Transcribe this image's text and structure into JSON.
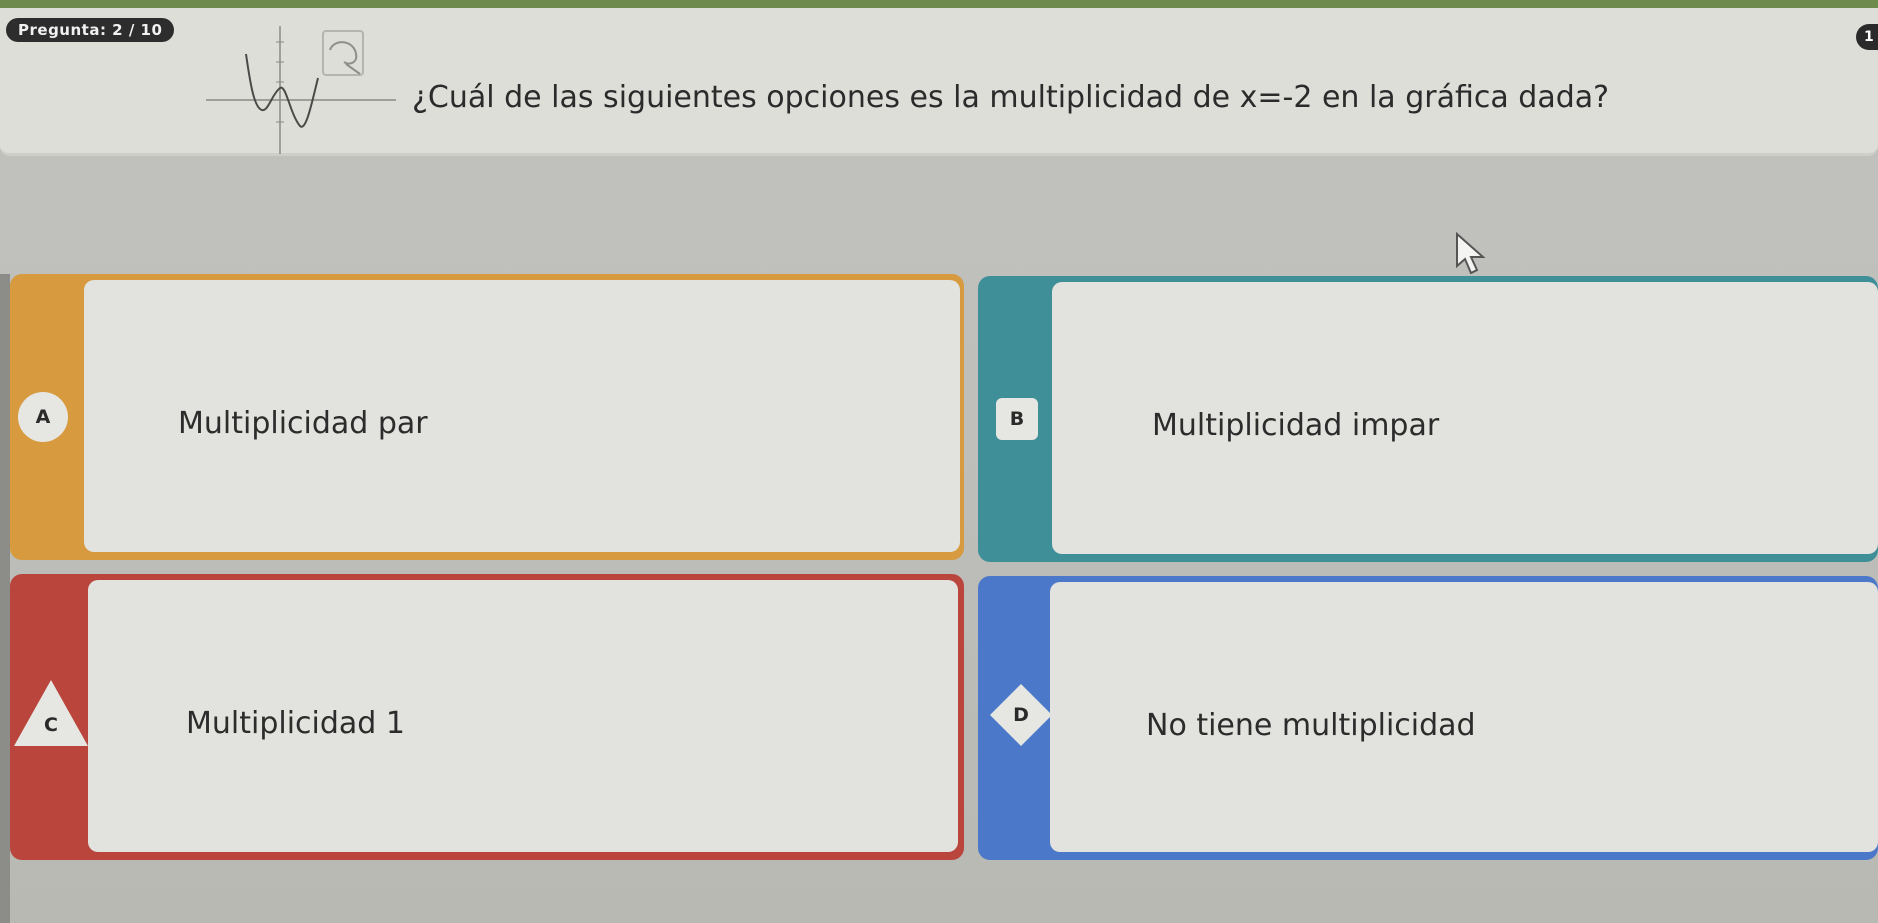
{
  "header": {
    "question_counter": "Pregunta: 2 / 10",
    "corner_badge": "1"
  },
  "question": {
    "text": "¿Cuál de las siguientes opciones es la multiplicidad de x=-2 en la gráfica dada?"
  },
  "options": [
    {
      "letter": "A",
      "label": "Multiplicidad par",
      "color": "#d79a3e",
      "shape": "circle"
    },
    {
      "letter": "B",
      "label": "Multiplicidad impar",
      "color": "#3f8f98",
      "shape": "square"
    },
    {
      "letter": "C",
      "label": "Multiplicidad 1",
      "color": "#b9453d",
      "shape": "triangle"
    },
    {
      "letter": "D",
      "label": "No tiene multiplicidad",
      "color": "#4b78c8",
      "shape": "diamond"
    }
  ],
  "icons": {
    "graph": "polynomial-graph-thumbnail",
    "zoom": "zoom-icon",
    "cursor": "mouse-pointer-icon"
  }
}
